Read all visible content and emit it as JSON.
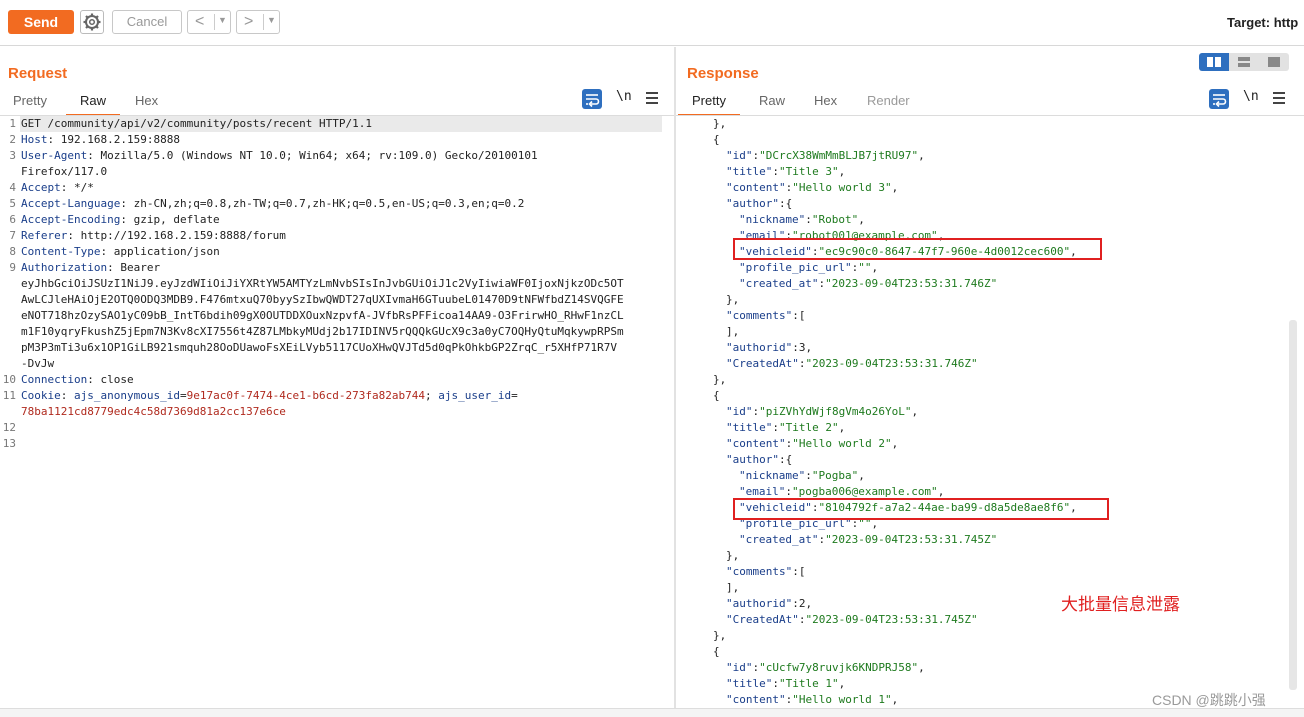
{
  "toolbar": {
    "send_label": "Send",
    "cancel_label": "Cancel",
    "back_label": "<",
    "forward_label": ">",
    "target_label": "Target: http"
  },
  "request": {
    "title": "Request",
    "tabs": [
      "Pretty",
      "Raw",
      "Hex"
    ],
    "active_tab": "Raw",
    "newline_label": "\\n",
    "lines": [
      {
        "n": "1",
        "text": "GET /community/api/v2/community/posts/recent HTTP/1.1"
      },
      {
        "n": "2",
        "key": "Host",
        "val": " 192.168.2.159:8888"
      },
      {
        "n": "3",
        "key": "User-Agent",
        "val": " Mozilla/5.0 (Windows NT 10.0; Win64; x64; rv:109.0) Gecko/20100101"
      },
      {
        "n": "",
        "text": "Firefox/117.0"
      },
      {
        "n": "4",
        "key": "Accept",
        "val": " */*"
      },
      {
        "n": "5",
        "key": "Accept-Language",
        "val": " zh-CN,zh;q=0.8,zh-TW;q=0.7,zh-HK;q=0.5,en-US;q=0.3,en;q=0.2"
      },
      {
        "n": "6",
        "key": "Accept-Encoding",
        "val": " gzip, deflate"
      },
      {
        "n": "7",
        "key": "Referer",
        "val": " http://192.168.2.159:8888/forum"
      },
      {
        "n": "8",
        "key": "Content-Type",
        "val": " application/json"
      },
      {
        "n": "9",
        "key": "Authorization",
        "val": " Bearer"
      },
      {
        "n": "",
        "text": "eyJhbGciOiJSUzI1NiJ9.eyJzdWIiOiJiYXRtYW5AMTYzLmNvbSIsInJvbGUiOiJ1c2VyIiwiaWF0IjoxNjkzODc5OT"
      },
      {
        "n": "",
        "text": "AwLCJleHAiOjE2OTQ0ODQ3MDB9.F476mtxuQ70byySzIbwQWDT27qUXIvmaH6GTuubeL01470D9tNFWfbdZ14SVQGFE"
      },
      {
        "n": "",
        "text": "eNOT718hzOzySAO1yC09bB_IntT6bdih09gX0OUTDDXOuxNzpvfA-JVfbRsPFFicoa14AA9-O3FrirwHO_RHwF1nzCL"
      },
      {
        "n": "",
        "text": "m1F10yqryFkushZ5jEpm7N3Kv8cXI7556t4Z87LMbkyMUdj2b17IDINV5rQQQkGUcX9c3a0yC7OQHyQtuMqkywpRPSm"
      },
      {
        "n": "",
        "text": "pM3P3mTi3u6x1OP1GiLB921smquh28OoDUawoFsXEiLVyb5117CUoXHwQVJTd5d0qPkOhkbGP2ZrqC_r5XHfP71R7V"
      },
      {
        "n": "",
        "text": "-DvJw"
      },
      {
        "n": "10",
        "key": "Connection",
        "val": " close"
      },
      {
        "n": "11",
        "cookie": true,
        "k1": "Cookie",
        "sep1": ": ",
        "c1k": "ajs_anonymous_id",
        "c1v": "9e17ac0f-7474-4ce1-b6cd-273fa82ab744",
        "sep2": "; ",
        "c2k": "ajs_user_id",
        "eq": "="
      },
      {
        "n": "",
        "red": "78ba1121cd8779edc4c58d7369d81a2cc137e6ce"
      },
      {
        "n": "12",
        "text": ""
      },
      {
        "n": "13",
        "text": ""
      }
    ]
  },
  "response": {
    "title": "Response",
    "tabs": [
      "Pretty",
      "Raw",
      "Hex",
      "Render"
    ],
    "active_tab": "Pretty",
    "newline_label": "\\n",
    "lines": [
      {
        "i": 3,
        "p": "},"
      },
      {
        "i": 3,
        "p": "{"
      },
      {
        "i": 4,
        "k": "\"id\"",
        "s": "\"DCrcX38WmMmBLJB7jtRU97\"",
        "e": ","
      },
      {
        "i": 4,
        "k": "\"title\"",
        "s": "\"Title 3\"",
        "e": ","
      },
      {
        "i": 4,
        "k": "\"content\"",
        "s": "\"Hello world 3\"",
        "e": ","
      },
      {
        "i": 4,
        "k": "\"author\"",
        "p2": ":{"
      },
      {
        "i": 5,
        "k": "\"nickname\"",
        "s": "\"Robot\"",
        "e": ","
      },
      {
        "i": 5,
        "k": "\"email\"",
        "s": "\"robot001@example.com\"",
        "e": ","
      },
      {
        "i": 5,
        "k": "\"vehicleid\"",
        "s": "\"ec9c90c0-8647-47f7-960e-4d0012cec600\"",
        "e": ","
      },
      {
        "i": 5,
        "k": "\"profile_pic_url\"",
        "s": "\"\"",
        "e": ","
      },
      {
        "i": 5,
        "k": "\"created_at\"",
        "s": "\"2023-09-04T23:53:31.746Z\"",
        "e": ""
      },
      {
        "i": 4,
        "p": "},"
      },
      {
        "i": 4,
        "k": "\"comments\"",
        "p2": ":["
      },
      {
        "i": 4,
        "p": "],"
      },
      {
        "i": 4,
        "k": "\"authorid\"",
        "n": "3",
        "e": ","
      },
      {
        "i": 4,
        "k": "\"CreatedAt\"",
        "s": "\"2023-09-04T23:53:31.746Z\"",
        "e": ""
      },
      {
        "i": 3,
        "p": "},"
      },
      {
        "i": 3,
        "p": "{"
      },
      {
        "i": 4,
        "k": "\"id\"",
        "s": "\"piZVhYdWjf8gVm4o26YoL\"",
        "e": ","
      },
      {
        "i": 4,
        "k": "\"title\"",
        "s": "\"Title 2\"",
        "e": ","
      },
      {
        "i": 4,
        "k": "\"content\"",
        "s": "\"Hello world 2\"",
        "e": ","
      },
      {
        "i": 4,
        "k": "\"author\"",
        "p2": ":{"
      },
      {
        "i": 5,
        "k": "\"nickname\"",
        "s": "\"Pogba\"",
        "e": ","
      },
      {
        "i": 5,
        "k": "\"email\"",
        "s": "\"pogba006@example.com\"",
        "e": ","
      },
      {
        "i": 5,
        "k": "\"vehicleid\"",
        "s": "\"8104792f-a7a2-44ae-ba99-d8a5de8ae8f6\"",
        "e": ","
      },
      {
        "i": 5,
        "k": "\"profile_pic_url\"",
        "s": "\"\"",
        "e": ","
      },
      {
        "i": 5,
        "k": "\"created_at\"",
        "s": "\"2023-09-04T23:53:31.745Z\"",
        "e": ""
      },
      {
        "i": 4,
        "p": "},"
      },
      {
        "i": 4,
        "k": "\"comments\"",
        "p2": ":["
      },
      {
        "i": 4,
        "p": "],"
      },
      {
        "i": 4,
        "k": "\"authorid\"",
        "n": "2",
        "e": ","
      },
      {
        "i": 4,
        "k": "\"CreatedAt\"",
        "s": "\"2023-09-04T23:53:31.745Z\"",
        "e": ""
      },
      {
        "i": 3,
        "p": "},"
      },
      {
        "i": 3,
        "p": "{"
      },
      {
        "i": 4,
        "k": "\"id\"",
        "s": "\"cUcfw7y8ruvjk6KNDPRJ58\"",
        "e": ","
      },
      {
        "i": 4,
        "k": "\"title\"",
        "s": "\"Title 1\"",
        "e": ","
      },
      {
        "i": 4,
        "k": "\"content\"",
        "s": "\"Hello world 1\"",
        "e": ","
      }
    ]
  },
  "annotation": "大批量信息泄露",
  "watermark": "CSDN @跳跳小强",
  "colors": {
    "accent": "#f26b21",
    "highlight_box": "#e02020",
    "json_key": "#1a3e8a",
    "json_string": "#1e7a1e",
    "cookie_value": "#b02a1e"
  },
  "icons": [
    "gear-icon",
    "wrap-lines-icon",
    "newline-toggle-icon",
    "hamburger-menu-icon",
    "layout-side-by-side-icon",
    "layout-stacked-icon",
    "layout-tabs-icon"
  ]
}
